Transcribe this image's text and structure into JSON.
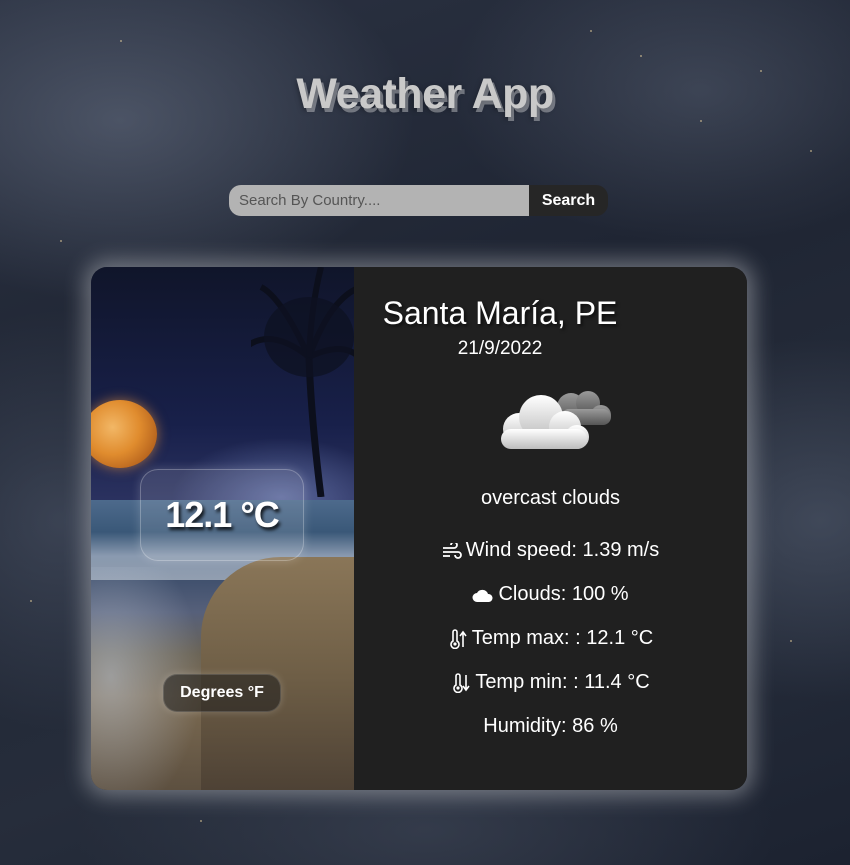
{
  "app": {
    "title": "Weather App"
  },
  "search": {
    "placeholder": "Search By Country....",
    "value": "",
    "button_label": "Search"
  },
  "card": {
    "temperature": "12.1 °C",
    "unit_toggle_label": "Degrees °F",
    "location": "Santa María, PE",
    "date": "21/9/2022",
    "weather_icon": "cloud-icon",
    "description": "overcast clouds",
    "stats": {
      "wind": "Wind speed: 1.39 m/s",
      "clouds": "Clouds: 100 %",
      "temp_max": "Temp max: : 12.1 °C",
      "temp_min": "Temp min: : 11.4 °C",
      "humidity": "Humidity: 86 %"
    }
  }
}
